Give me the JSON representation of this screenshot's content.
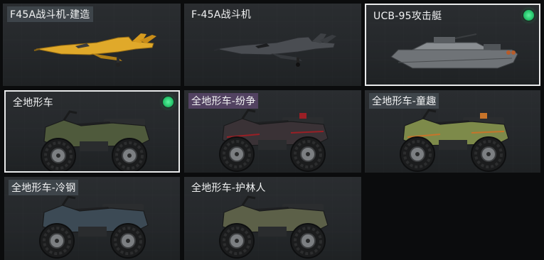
{
  "items": [
    {
      "label": "F45A战斗机-建造",
      "selected": false,
      "equipped": false,
      "kind": "jet",
      "color": "#e0a92a"
    },
    {
      "label": "F-45A战斗机",
      "selected": false,
      "equipped": false,
      "kind": "jet",
      "color": "#4a4d52"
    },
    {
      "label": "UCB-95攻击艇",
      "selected": true,
      "equipped": true,
      "kind": "boat",
      "color": "#7a7e82"
    },
    {
      "label": "全地形车",
      "selected": true,
      "equipped": true,
      "kind": "atv",
      "color": "#4f5a3c"
    },
    {
      "label": "全地形车-纷争",
      "selected": false,
      "equipped": false,
      "kind": "atv",
      "color": "#3a3236"
    },
    {
      "label": "全地形车-童趣",
      "selected": false,
      "equipped": false,
      "kind": "atv",
      "color": "#7d8a4a"
    },
    {
      "label": "全地形车-冷钢",
      "selected": false,
      "equipped": false,
      "kind": "atv",
      "color": "#3c4a55"
    },
    {
      "label": "全地形车-护林人",
      "selected": false,
      "equipped": false,
      "kind": "atv",
      "color": "#5c6048"
    }
  ],
  "colors": {
    "selection_border": "#e9eaeb",
    "equipped_indicator": "#2ed47a"
  }
}
